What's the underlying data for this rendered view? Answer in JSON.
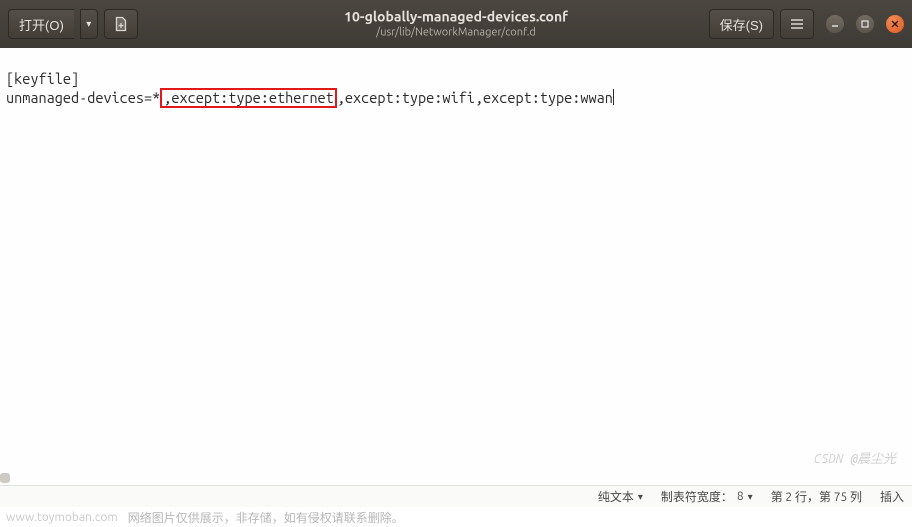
{
  "titlebar": {
    "open_label": "打开(O)",
    "title": "10-globally-managed-devices.conf",
    "subtitle": "/usr/lib/NetworkManager/conf.d",
    "save_label": "保存(S)"
  },
  "editor": {
    "line1": "[keyfile]",
    "line2_prefix": "unmanaged-devices=*",
    "line2_highlight": ",except:type:ethernet",
    "line2_suffix": ",except:type:wifi,except:type:wwan"
  },
  "statusbar": {
    "syntax": "纯文本",
    "tab_label": "制表符宽度：",
    "tab_value": "8",
    "position": "第 2 行，第 75 列",
    "mode": "插入"
  },
  "footer": {
    "domain": "www.toymoban.com",
    "note": "网络图片仅供展示，非存储，如有侵权请联系删除。"
  },
  "watermark": "CSDN @晨尘光"
}
